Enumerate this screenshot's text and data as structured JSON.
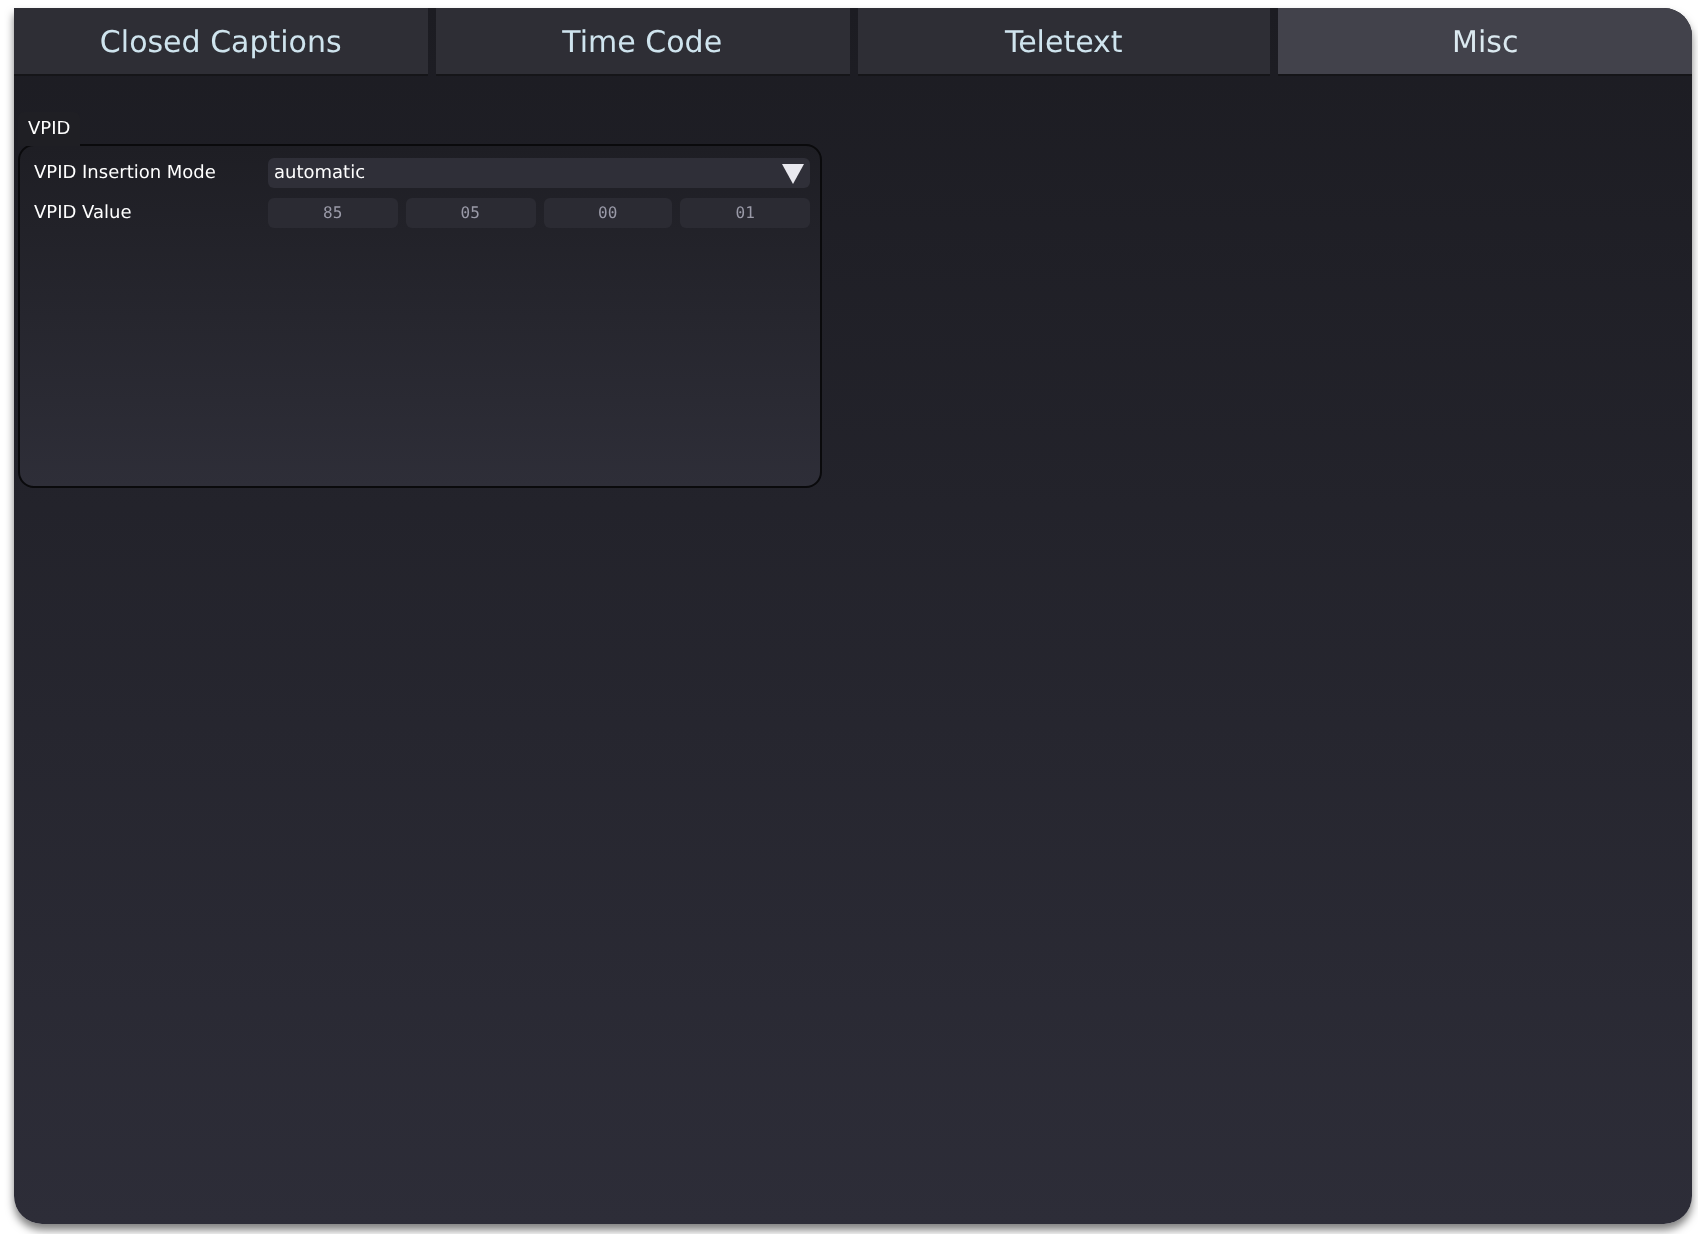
{
  "tabs": [
    {
      "label": "Closed Captions",
      "selected": false
    },
    {
      "label": "Time Code",
      "selected": false
    },
    {
      "label": "Teletext",
      "selected": false
    },
    {
      "label": "Misc",
      "selected": true
    }
  ],
  "group": {
    "title": "VPID",
    "insertion_mode": {
      "label": "VPID Insertion Mode",
      "value": "automatic"
    },
    "vpid_value": {
      "label": "VPID Value",
      "bytes": [
        "85",
        "05",
        "00",
        "01"
      ]
    }
  }
}
